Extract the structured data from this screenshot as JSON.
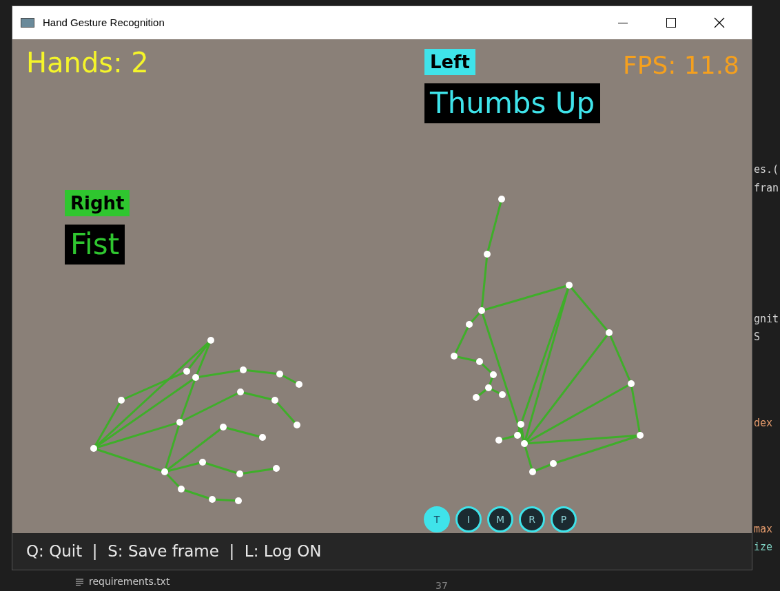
{
  "window": {
    "title": "Hand Gesture Recognition"
  },
  "overlay": {
    "hands_count": "Hands: 2",
    "fps": "FPS: 11.8"
  },
  "detections": [
    {
      "label": "Right",
      "gesture": "Fist",
      "color": "#2fc62f"
    },
    {
      "label": "Left",
      "gesture": "Thumbs Up",
      "color": "#3fe3ea"
    }
  ],
  "finger_indicators": [
    {
      "label": "T",
      "selected": true
    },
    {
      "label": "I",
      "selected": false
    },
    {
      "label": "M",
      "selected": false
    },
    {
      "label": "R",
      "selected": false
    },
    {
      "label": "P",
      "selected": false
    }
  ],
  "status_bar": {
    "text": "Q: Quit  |  S: Save frame  |  L: Log ON"
  },
  "editor": {
    "code_fragments": [
      {
        "text": "es.(",
        "kind": "plain"
      },
      {
        "text": "fran",
        "kind": "plain"
      },
      {
        "text": "gnit",
        "kind": "plain"
      },
      {
        "text": "S",
        "kind": "plain"
      },
      {
        "text": "dex",
        "kind": "param"
      },
      {
        "text": "max",
        "kind": "param"
      },
      {
        "text": "ize",
        "kind": "name"
      }
    ],
    "file": "requirements.txt",
    "line_number": "37"
  }
}
